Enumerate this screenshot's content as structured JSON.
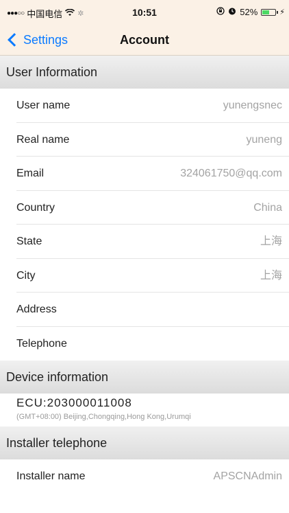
{
  "status_bar": {
    "carrier": "中国电信",
    "time": "10:51",
    "battery_percent": "52%",
    "battery_level": 0.52
  },
  "nav": {
    "back_label": "Settings",
    "title": "Account"
  },
  "sections": {
    "user_info": {
      "header": "User Information",
      "rows": [
        {
          "label": "User name",
          "value": "yunengsnec"
        },
        {
          "label": "Real name",
          "value": "yuneng"
        },
        {
          "label": "Email",
          "value": "324061750@qq.com"
        },
        {
          "label": "Country",
          "value": "China"
        },
        {
          "label": "State",
          "value": "上海"
        },
        {
          "label": "City",
          "value": "上海"
        },
        {
          "label": "Address",
          "value": ""
        },
        {
          "label": "Telephone",
          "value": ""
        }
      ]
    },
    "device_info": {
      "header": "Device information",
      "ecu_id": "ECU:203000011008",
      "timezone": "(GMT+08:00) Beijing,Chongqing,Hong Kong,Urumqi"
    },
    "installer": {
      "header": "Installer telephone",
      "rows": [
        {
          "label": "Installer name",
          "value": "APSCNAdmin"
        }
      ]
    }
  },
  "colors": {
    "bar_background": "#fbf1e6",
    "accent": "#0a7aff",
    "value_text": "#a3a3a3"
  }
}
